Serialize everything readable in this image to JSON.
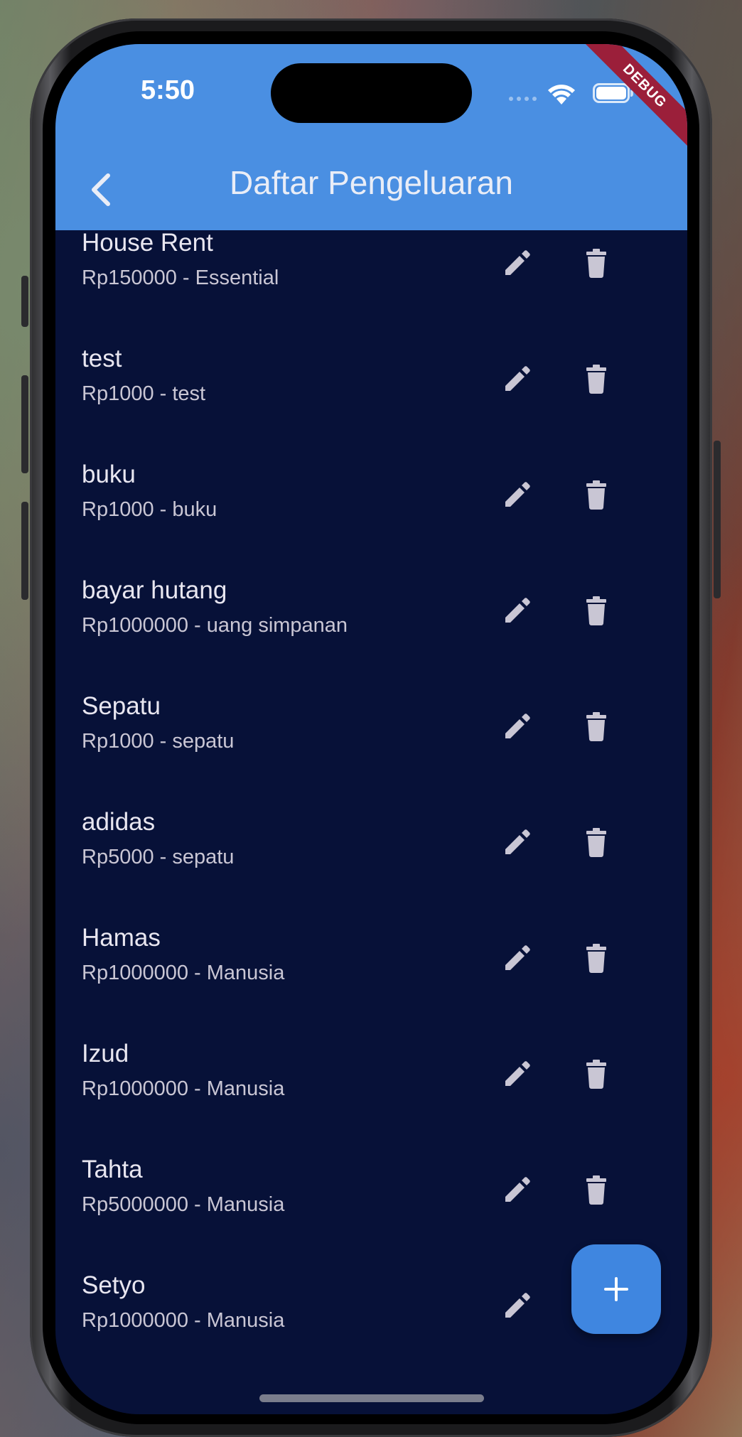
{
  "status_bar": {
    "time": "5:50",
    "icons": [
      "signal-dots-icon",
      "wifi-icon",
      "battery-icon"
    ]
  },
  "debug_banner": "DEBUG",
  "app_bar": {
    "back_icon": "chevron-left-icon",
    "title": "Daftar Pengeluaran"
  },
  "expenses": [
    {
      "name": "House Rent",
      "detail": "Rp150000 - Essential"
    },
    {
      "name": "test",
      "detail": "Rp1000 - test"
    },
    {
      "name": "buku",
      "detail": "Rp1000 - buku"
    },
    {
      "name": "bayar hutang",
      "detail": "Rp1000000 - uang simpanan"
    },
    {
      "name": "Sepatu",
      "detail": "Rp1000 - sepatu"
    },
    {
      "name": "adidas",
      "detail": "Rp5000 - sepatu"
    },
    {
      "name": "Hamas",
      "detail": "Rp1000000 - Manusia"
    },
    {
      "name": "Izud",
      "detail": "Rp1000000 - Manusia"
    },
    {
      "name": "Tahta",
      "detail": "Rp5000000 - Manusia"
    },
    {
      "name": "Setyo",
      "detail": "Rp1000000 - Manusia"
    }
  ],
  "row_actions": {
    "edit_icon": "pencil-icon",
    "delete_icon": "trash-icon"
  },
  "fab": {
    "icon": "plus-icon"
  },
  "colors": {
    "app_bar": "#4a8fe2",
    "background": "#071138",
    "fab": "#3f86e0",
    "icon": "#c9c6d4",
    "debug": "#9b1f3a"
  }
}
